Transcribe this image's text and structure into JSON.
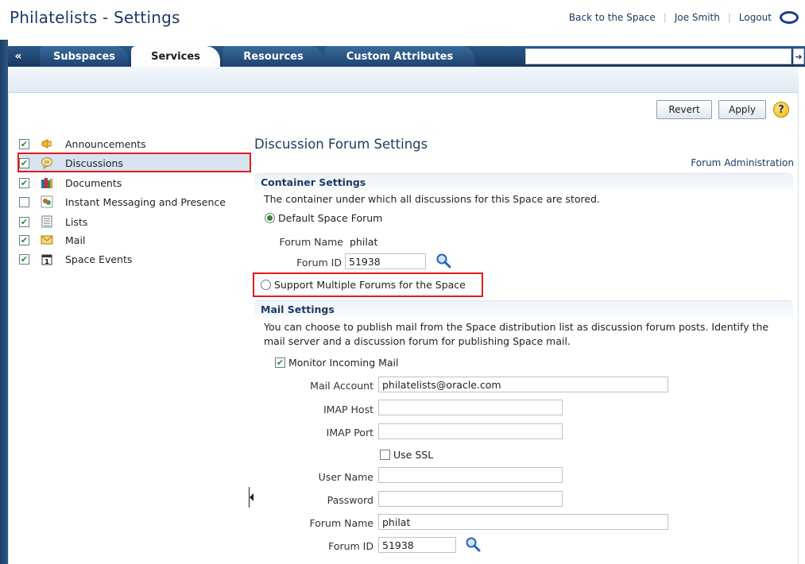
{
  "header": {
    "title": "Philatelists - Settings",
    "links": [
      "Back to the Space",
      "Joe Smith",
      "Logout"
    ]
  },
  "tabs": [
    {
      "label": "Subspaces",
      "active": false
    },
    {
      "label": "Services",
      "active": true
    },
    {
      "label": "Resources",
      "active": false
    },
    {
      "label": "Custom Attributes",
      "active": false
    }
  ],
  "toolbar": {
    "revert": "Revert",
    "apply": "Apply",
    "help": "?"
  },
  "services": [
    {
      "label": "Announcements",
      "checked": true,
      "icon": "megaphone-icon"
    },
    {
      "label": "Discussions",
      "checked": true,
      "icon": "speech-bubble-icon",
      "selected": true
    },
    {
      "label": "Documents",
      "checked": true,
      "icon": "books-icon"
    },
    {
      "label": "Instant Messaging and Presence",
      "checked": false,
      "icon": "chat-people-icon"
    },
    {
      "label": "Lists",
      "checked": true,
      "icon": "list-icon"
    },
    {
      "label": "Mail",
      "checked": true,
      "icon": "envelope-icon"
    },
    {
      "label": "Space Events",
      "checked": true,
      "icon": "calendar-icon"
    }
  ],
  "settings": {
    "title": "Discussion Forum Settings",
    "forum_admin_link": "Forum Administration",
    "container": {
      "heading": "Container Settings",
      "description": "The container under which all discussions for this Space are stored.",
      "default_option": "Default Space Forum",
      "forum_name_label": "Forum Name",
      "forum_name_value": "philat",
      "forum_id_label": "Forum ID",
      "forum_id_value": "51938",
      "multiple_option": "Support Multiple Forums for the Space"
    },
    "mail": {
      "heading": "Mail Settings",
      "description_line1": "You can choose to publish mail from the Space distribution list as discussion forum posts. Identify the",
      "description_line2": "mail server and a discussion forum for publishing Space mail.",
      "monitor_label": "Monitor Incoming Mail",
      "monitor_checked": true,
      "mail_account_label": "Mail Account",
      "mail_account_value": "philatelists@oracle.com",
      "imap_host_label": "IMAP Host",
      "imap_host_value": "",
      "imap_port_label": "IMAP Port",
      "imap_port_value": "",
      "use_ssl_label": "Use SSL",
      "use_ssl_checked": false,
      "user_name_label": "User Name",
      "user_name_value": "",
      "password_label": "Password",
      "password_value": "",
      "forum_name_label": "Forum Name",
      "forum_name_value": "philat",
      "forum_id_label": "Forum ID",
      "forum_id_value": "51938"
    }
  },
  "colors": {
    "brand_blue": "#1e3a64",
    "tab_bar": "#18385e",
    "highlight_red": "#e21b1b",
    "check_green": "#2e8b2e"
  }
}
